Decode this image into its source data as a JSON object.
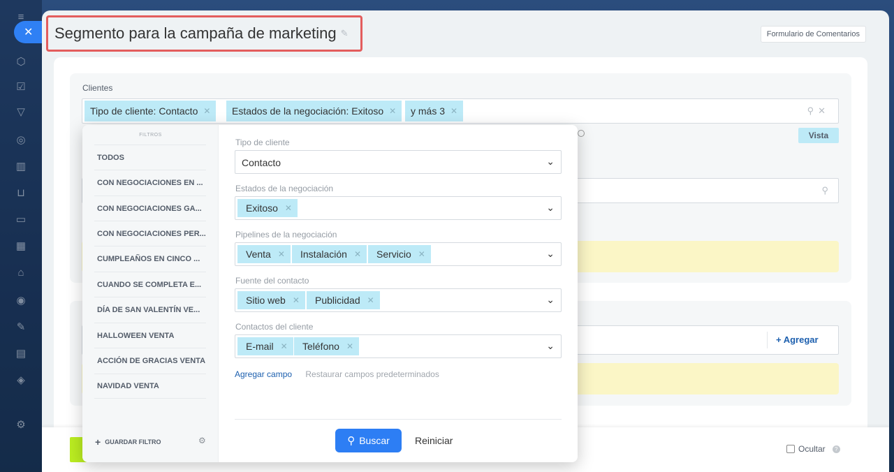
{
  "page": {
    "title": "Segmento para la campaña de marketing",
    "feedback_button": "Formulario de Comentarios",
    "close_glyph": "✕"
  },
  "clients_section": {
    "label": "Clientes",
    "tags": [
      {
        "label": "Tipo de cliente: Contacto"
      },
      {
        "label": "Estados de la negociación: Exitoso"
      },
      {
        "label": "y más 3"
      }
    ],
    "view_button": "Vista"
  },
  "recipients_section": {
    "add_button": "+ Agregar"
  },
  "footer": {
    "hide_label": "Ocultar"
  },
  "filter_popup": {
    "presets_title": "FILTROS",
    "presets": [
      "TODOS",
      "CON NEGOCIACIONES EN ...",
      "CON NEGOCIACIONES GA...",
      "CON NEGOCIACIONES PER...",
      "CUMPLEAÑOS EN CINCO ...",
      "CUANDO SE COMPLETA E...",
      "DÍA DE SAN VALENTÍN VE...",
      "HALLOWEEN VENTA",
      "ACCIÓN DE GRACIAS VENTA",
      "NAVIDAD VENTA"
    ],
    "save_filter": "GUARDAR FILTRO",
    "fields": {
      "client_type": {
        "label": "Tipo de cliente",
        "value": "Contacto"
      },
      "deal_status": {
        "label": "Estados de la negociación",
        "tags": [
          "Exitoso"
        ]
      },
      "pipelines": {
        "label": "Pipelines de la negociación",
        "tags": [
          "Venta",
          "Instalación",
          "Servicio"
        ]
      },
      "contact_source": {
        "label": "Fuente del contacto",
        "tags": [
          "Sitio web",
          "Publicidad"
        ]
      },
      "client_contacts": {
        "label": "Contactos del cliente",
        "tags": [
          "E-mail",
          "Teléfono"
        ]
      }
    },
    "add_field_link": "Agregar campo",
    "restore_link": "Restaurar campos predeterminados",
    "search_button": "Buscar",
    "reset_button": "Reiniciar"
  },
  "icons": [
    "close-icon",
    "edit-pencil-icon",
    "search-icon",
    "clear-icon",
    "chevron-down-icon",
    "remove-tag-icon",
    "gear-icon",
    "plus-icon",
    "help-icon"
  ]
}
